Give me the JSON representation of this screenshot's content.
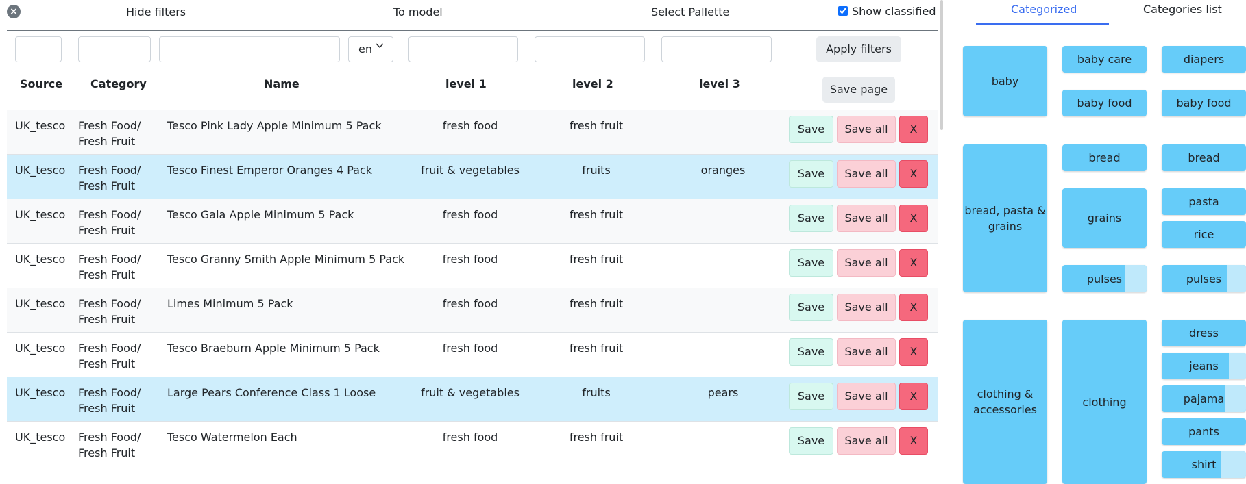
{
  "toolbar": {
    "hide_filters": "Hide filters",
    "to_model": "To model",
    "select_pallette": "Select Pallette",
    "show_classified": "Show classified",
    "close_symbol": "×"
  },
  "filters": {
    "language": "en",
    "apply_label": "Apply filters",
    "save_page_label": "Save page"
  },
  "table": {
    "headers": [
      "Source",
      "Category",
      "Name",
      "level 1",
      "level 2",
      "level 3"
    ],
    "rows": [
      {
        "source": "UK_tesco",
        "category": [
          "Fresh Food/",
          "Fresh Fruit"
        ],
        "name": "Tesco Pink Lady Apple Minimum 5 Pack",
        "level1": "fresh food",
        "level2": "fresh fruit",
        "level3": ""
      },
      {
        "source": "UK_tesco",
        "category": [
          "Fresh Food/",
          "Fresh Fruit"
        ],
        "name": "Tesco Finest Emperor Oranges 4 Pack",
        "level1": "fruit & vegetables",
        "level2": "fruits",
        "level3": "oranges"
      },
      {
        "source": "UK_tesco",
        "category": [
          "Fresh Food/",
          "Fresh Fruit"
        ],
        "name": "Tesco Gala Apple Minimum 5 Pack",
        "level1": "fresh food",
        "level2": "fresh fruit",
        "level3": ""
      },
      {
        "source": "UK_tesco",
        "category": [
          "Fresh Food/",
          "Fresh Fruit"
        ],
        "name": "Tesco Granny Smith Apple Minimum 5 Pack",
        "level1": "fresh food",
        "level2": "fresh fruit",
        "level3": ""
      },
      {
        "source": "UK_tesco",
        "category": [
          "Fresh Food/",
          "Fresh Fruit"
        ],
        "name": "Limes Minimum 5 Pack",
        "level1": "fresh food",
        "level2": "fresh fruit",
        "level3": ""
      },
      {
        "source": "UK_tesco",
        "category": [
          "Fresh Food/",
          "Fresh Fruit"
        ],
        "name": "Tesco Braeburn Apple Minimum 5 Pack",
        "level1": "fresh food",
        "level2": "fresh fruit",
        "level3": ""
      },
      {
        "source": "UK_tesco",
        "category": [
          "Fresh Food/",
          "Fresh Fruit"
        ],
        "name": "Large Pears Conference Class 1 Loose",
        "level1": "fruit & vegetables",
        "level2": "fruits",
        "level3": "pears"
      },
      {
        "source": "UK_tesco",
        "category": [
          "Fresh Food/",
          "Fresh Fruit"
        ],
        "name": "Tesco Watermelon Each",
        "level1": "fresh food",
        "level2": "fresh fruit",
        "level3": ""
      }
    ],
    "row_buttons": {
      "save": "Save",
      "save_all": "Save all",
      "delete": "X"
    }
  },
  "right_panel": {
    "tabs": [
      "Categorized",
      "Categories list"
    ],
    "groups": [
      {
        "level1": "baby",
        "level2": [
          {
            "label": "baby care",
            "level3": [
              {
                "label": "diapers",
                "fill": 1.0
              }
            ]
          },
          {
            "label": "baby food",
            "level3": [
              {
                "label": "baby food",
                "fill": 1.0
              }
            ]
          }
        ]
      },
      {
        "level1": "bread, pasta & grains",
        "level2": [
          {
            "label": "bread",
            "level3": [
              {
                "label": "bread",
                "fill": 1.0
              }
            ]
          },
          {
            "label": "grains",
            "level3": [
              {
                "label": "pasta",
                "fill": 1.0
              },
              {
                "label": "rice",
                "fill": 1.0
              }
            ]
          },
          {
            "label": "pulses",
            "fill": 0.75,
            "level3": [
              {
                "label": "pulses",
                "fill": 0.78
              }
            ]
          }
        ]
      },
      {
        "level1": "clothing & accessories",
        "level2": [
          {
            "label": "clothing",
            "level3": [
              {
                "label": "dress",
                "fill": 1.0
              },
              {
                "label": "jeans",
                "fill": 0.8
              },
              {
                "label": "pajama",
                "fill": 0.75
              },
              {
                "label": "pants",
                "fill": 1.0
              },
              {
                "label": "shirt",
                "fill": 0.7
              }
            ]
          }
        ]
      }
    ]
  },
  "colors": {
    "tile": "#66ccf9",
    "tile_unfilled": "#bfe9fb",
    "row_highlight": "#cfeefc",
    "save_btn": "#d8f8f0",
    "save_all_btn": "#fbd0d7",
    "delete_btn": "#f5687d",
    "tab_active": "#3a6df0"
  }
}
